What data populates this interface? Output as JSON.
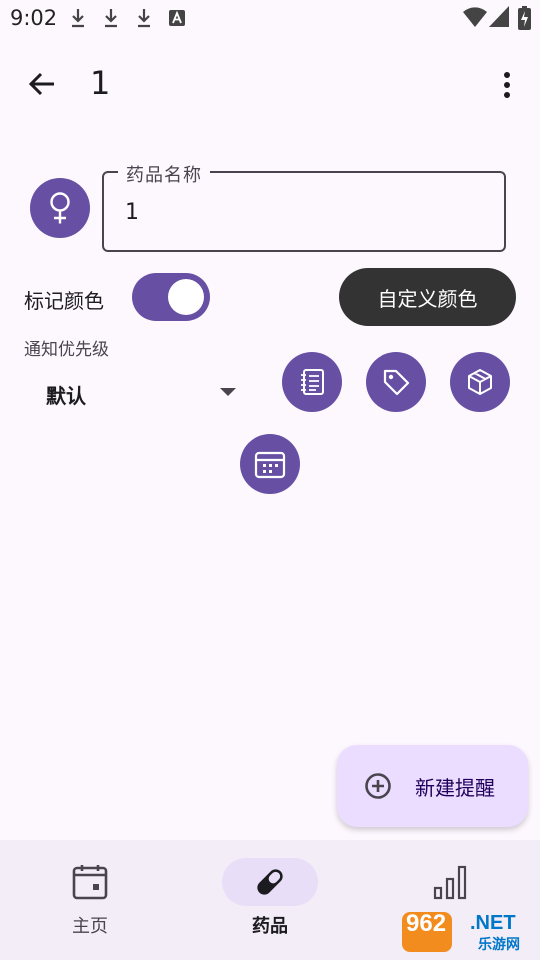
{
  "status_bar": {
    "time": "9:02",
    "notification_icons": [
      "download-icon",
      "download-icon",
      "download-icon",
      "a-letter-icon"
    ],
    "system_icons": [
      "wifi-icon",
      "signal-icon",
      "battery-charging-icon"
    ]
  },
  "app_bar": {
    "title": "1",
    "back_icon": "arrow-left-icon",
    "menu_icon": "more-vert-icon"
  },
  "form": {
    "avatar_icon": "female-icon",
    "name_field": {
      "label": "药品名称",
      "value": "1"
    },
    "color_label": "标记颜色",
    "color_switch_on": true,
    "custom_color_button": "自定义颜色",
    "priority_label": "通知优先级",
    "priority_value": "默认",
    "action_icons": [
      "notes-icon",
      "tag-icon",
      "box-icon",
      "calendar-icon"
    ]
  },
  "fab": {
    "label": "新建提醒",
    "icon": "add-circle-icon"
  },
  "bottom_nav": {
    "items": [
      {
        "label": "主页",
        "icon": "calendar-icon",
        "active": false
      },
      {
        "label": "药品",
        "icon": "pill-icon",
        "active": true
      },
      {
        "label": "",
        "icon": "bar-chart-icon",
        "active": false
      }
    ]
  },
  "watermark": {
    "number": "962",
    "net": ".NET",
    "site": "乐游网"
  },
  "colors": {
    "primary": "#6750a4",
    "background": "#fdf7fe",
    "fab_container": "#eaddff",
    "nav_background": "#f3edf7",
    "nav_active_pill": "#e8def8",
    "tooltip_dark": "#333333"
  }
}
